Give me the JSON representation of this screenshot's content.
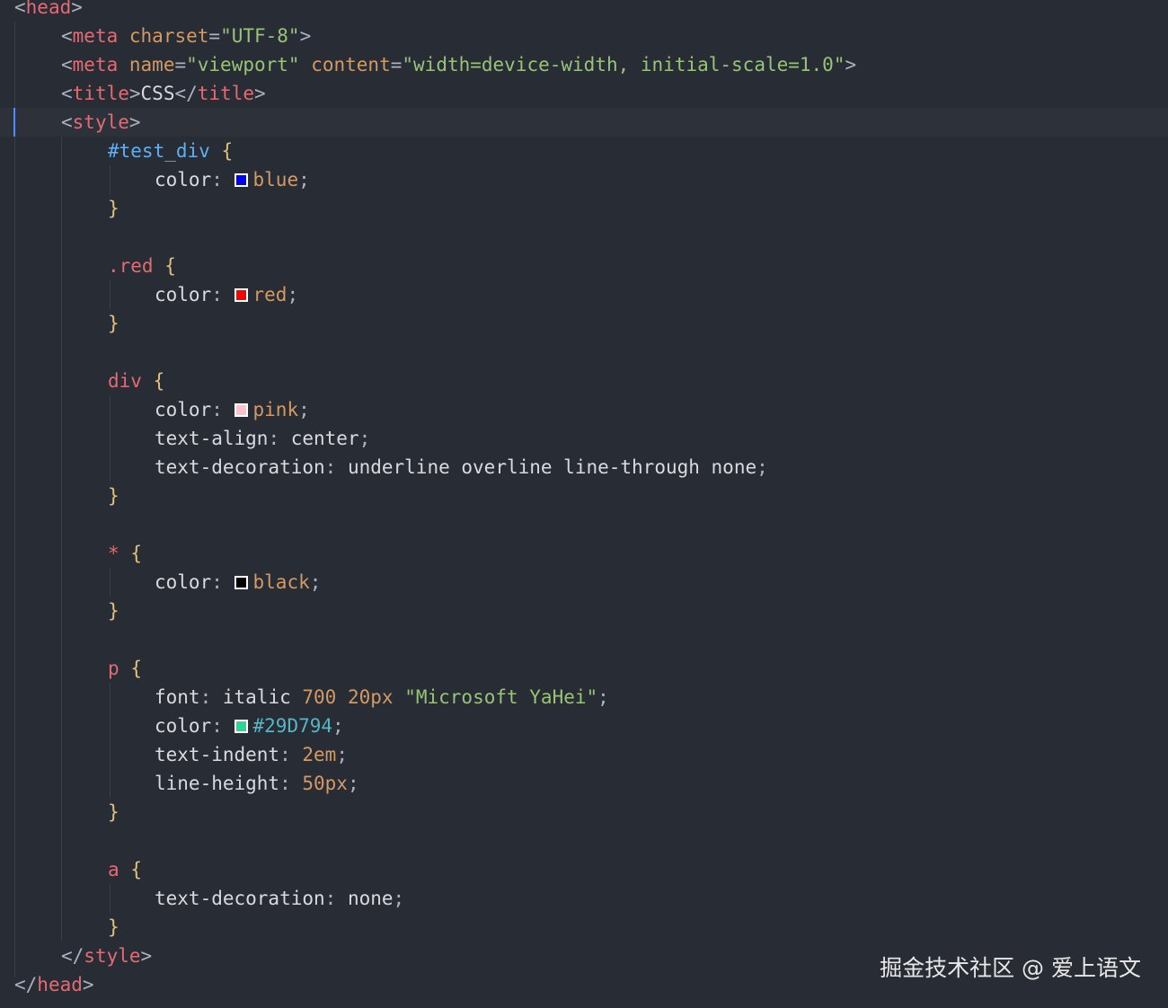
{
  "editor": {
    "background": "#282c34",
    "current_line_background": "#2c313a",
    "lines": [
      {
        "text": "<head>",
        "segments": [
          "<",
          "head",
          ">"
        ]
      },
      {
        "segments": [
          "<",
          "meta",
          " ",
          "charset",
          "=",
          "\"UTF-8\"",
          ">"
        ]
      },
      {
        "segments": [
          "<",
          "meta",
          " ",
          "name",
          "=",
          "\"viewport\"",
          " ",
          "content",
          "=",
          "\"width=device-width, initial-scale=1.0\"",
          ">"
        ]
      },
      {
        "segments": [
          "<",
          "title",
          ">",
          "CSS",
          "</",
          "title",
          ">"
        ]
      },
      {
        "segments": [
          "<",
          "style",
          ">"
        ]
      },
      {
        "segments": [
          "#test_div",
          " ",
          "{"
        ]
      },
      {
        "segments": [
          "color",
          ": ",
          "blue",
          ";"
        ]
      },
      {
        "segments": [
          "}"
        ]
      },
      {
        "segments": [
          ".red",
          " ",
          "{"
        ]
      },
      {
        "segments": [
          "color",
          ": ",
          "red",
          ";"
        ]
      },
      {
        "segments": [
          "}"
        ]
      },
      {
        "segments": [
          "div",
          " ",
          "{"
        ]
      },
      {
        "segments": [
          "color",
          ": ",
          "pink",
          ";"
        ]
      },
      {
        "segments": [
          "text-align",
          ": ",
          "center",
          ";"
        ]
      },
      {
        "segments": [
          "text-decoration",
          ": ",
          "underline overline line-through none",
          ";"
        ]
      },
      {
        "segments": [
          "}"
        ]
      },
      {
        "segments": [
          "*",
          " ",
          "{"
        ]
      },
      {
        "segments": [
          "color",
          ": ",
          "black",
          ";"
        ]
      },
      {
        "segments": [
          "}"
        ]
      },
      {
        "segments": [
          "p",
          " ",
          "{"
        ]
      },
      {
        "segments": [
          "font",
          ": ",
          "italic ",
          "700",
          " ",
          "20px",
          " ",
          "\"Microsoft YaHei\"",
          ";"
        ]
      },
      {
        "segments": [
          "color",
          ": ",
          "#29D794",
          ";"
        ]
      },
      {
        "segments": [
          "text-indent",
          ": ",
          "2em",
          ";"
        ]
      },
      {
        "segments": [
          "line-height",
          ": ",
          "50px",
          ";"
        ]
      },
      {
        "segments": [
          "}"
        ]
      },
      {
        "segments": [
          "a",
          " ",
          "{"
        ]
      },
      {
        "segments": [
          "text-decoration",
          ": ",
          "none",
          ";"
        ]
      },
      {
        "segments": [
          "}"
        ]
      },
      {
        "segments": [
          "</",
          "style",
          ">"
        ]
      },
      {
        "segments": [
          "</",
          "head",
          ">"
        ]
      }
    ]
  },
  "swatches": {
    "blue": "#0000ff",
    "red": "#ff0000",
    "pink": "#ffc0cb",
    "black": "#000000",
    "green": "#29d794"
  },
  "watermark": "掘金技术社区 @ 爱上语文"
}
